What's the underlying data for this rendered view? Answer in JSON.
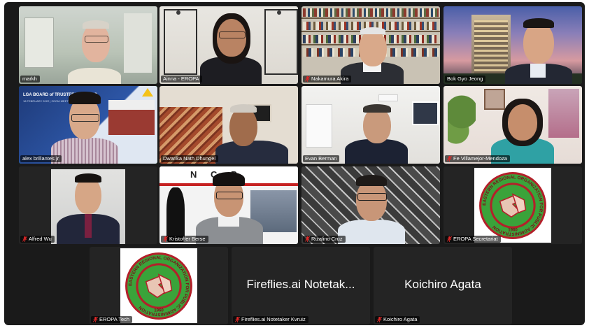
{
  "participants": [
    {
      "name": "markh",
      "muted": false
    },
    {
      "name": "Ainna - EROPA",
      "muted": false
    },
    {
      "name": "Nakamura Akira",
      "muted": true
    },
    {
      "name": "Bok Gyo Jeong",
      "muted": false
    },
    {
      "name": "alex brillantes jr",
      "muted": false,
      "active_speaker": true
    },
    {
      "name": "Dwarika Nath  Dhungel",
      "muted": false
    },
    {
      "name": "Evan Berman",
      "muted": false
    },
    {
      "name": "Fe Villamejor-Mendoza",
      "muted": true
    },
    {
      "name": "Alfred Wu",
      "muted": true
    },
    {
      "name": "Kristoffer Berse",
      "muted": true
    },
    {
      "name": "Rizalino Cruz",
      "muted": true
    },
    {
      "name": "EROPA Secretariat",
      "muted": true
    },
    {
      "name": "EROPA Tech",
      "muted": true
    },
    {
      "name": "Fireflies.ai Notetaker Kvruiz",
      "muted": true,
      "display_text": "Fireflies.ai Notetak..."
    },
    {
      "name": "Koichiro Agata",
      "muted": true,
      "display_text": "Koichiro Agata"
    }
  ],
  "slide": {
    "title": "LGA BOARD of TRUSTEES MEETING",
    "date": "18 FEBRUARY 2022  |  ZOOM MEETING"
  },
  "poster": {
    "letters": "N C P"
  },
  "logo": {
    "ring_text": "EASTERN REGIONAL ORGANIZATION FOR PUBLIC ADMINISTRATION",
    "year": "1960"
  },
  "colors": {
    "active_speaker": "#23d959",
    "muted_icon": "#e02828",
    "tile_bg": "#242424",
    "logo_green": "#3aa33a",
    "logo_red": "#b3202a"
  }
}
